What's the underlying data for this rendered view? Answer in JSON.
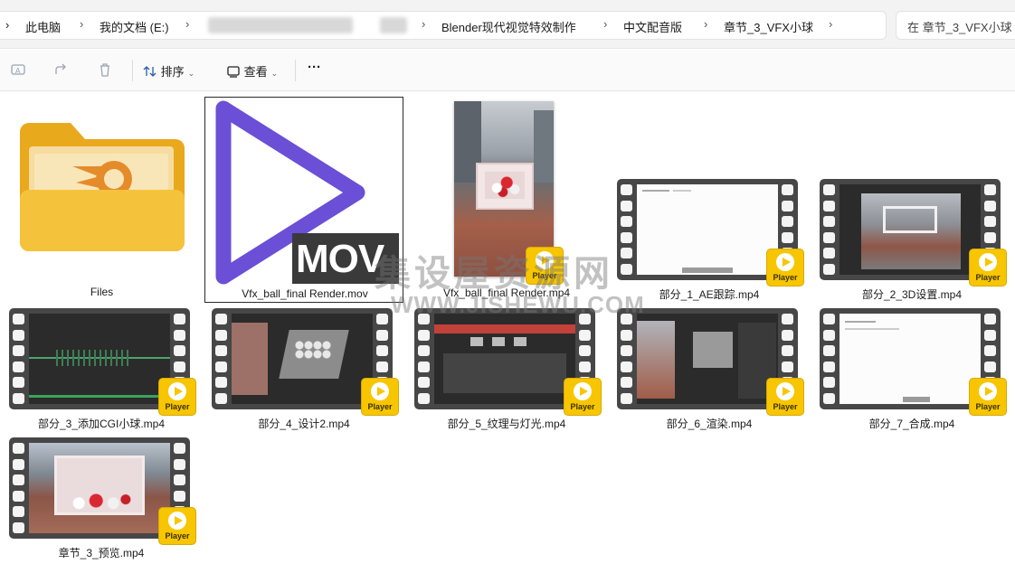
{
  "breadcrumb": {
    "items": [
      "此电脑",
      "我的文档 (E:)",
      "Blender现代视觉特效制作",
      "中文配音版",
      "章节_3_VFX小球"
    ],
    "search_placeholder": "在 章节_3_VFX小球"
  },
  "toolbar": {
    "sort_label": "排序",
    "view_label": "查看",
    "more_label": "···",
    "rename_icon": "rename-icon",
    "share_icon": "share-icon",
    "delete_icon": "trash-icon"
  },
  "files": [
    {
      "name": "Files",
      "type": "folder"
    },
    {
      "name": "Vfx_ball_final Render.mov",
      "type": "mov",
      "badge": "MOV"
    },
    {
      "name": "Vfx_ball_final Render.mp4",
      "type": "video"
    },
    {
      "name": "部分_1_AE跟踪.mp4",
      "type": "video"
    },
    {
      "name": "部分_2_3D设置.mp4",
      "type": "video"
    },
    {
      "name": "部分_3_添加CGI小球.mp4",
      "type": "video"
    },
    {
      "name": "部分_4_设计2.mp4",
      "type": "video"
    },
    {
      "name": "部分_5_纹理与灯光.mp4",
      "type": "video"
    },
    {
      "name": "部分_6_渲染.mp4",
      "type": "video"
    },
    {
      "name": "部分_7_合成.mp4",
      "type": "video"
    },
    {
      "name": "章节_3_预览.mp4",
      "type": "video"
    }
  ],
  "player_badge": "Player",
  "watermark": {
    "line1": "集设屋资源网",
    "line2": "WWW.JISHEWU.COM"
  },
  "colors": {
    "accent_purple": "#6b4fd6",
    "player_yellow": "#f7c600",
    "folder_yellow": "#f5c33b"
  }
}
